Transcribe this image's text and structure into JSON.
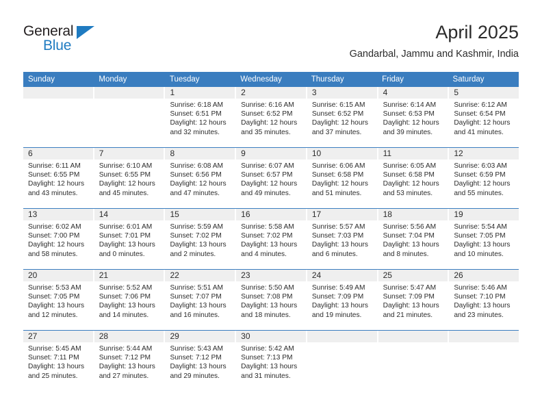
{
  "brand": {
    "name_part1": "General",
    "name_part2": "Blue",
    "accent_color": "#1f7bc1"
  },
  "header": {
    "title": "April 2025",
    "subtitle": "Gandarbal, Jammu and Kashmir, India"
  },
  "colors": {
    "header_blue": "#3a7dbf",
    "day_band_gray": "#efefef",
    "text": "#2b2b2b"
  },
  "weekdays": [
    "Sunday",
    "Monday",
    "Tuesday",
    "Wednesday",
    "Thursday",
    "Friday",
    "Saturday"
  ],
  "weeks": [
    [
      {
        "day": "",
        "sunrise": "",
        "sunset": "",
        "daylight_line1": "",
        "daylight_line2": "",
        "empty": true
      },
      {
        "day": "",
        "sunrise": "",
        "sunset": "",
        "daylight_line1": "",
        "daylight_line2": "",
        "empty": true
      },
      {
        "day": "1",
        "sunrise": "Sunrise: 6:18 AM",
        "sunset": "Sunset: 6:51 PM",
        "daylight_line1": "Daylight: 12 hours",
        "daylight_line2": "and 32 minutes."
      },
      {
        "day": "2",
        "sunrise": "Sunrise: 6:16 AM",
        "sunset": "Sunset: 6:52 PM",
        "daylight_line1": "Daylight: 12 hours",
        "daylight_line2": "and 35 minutes."
      },
      {
        "day": "3",
        "sunrise": "Sunrise: 6:15 AM",
        "sunset": "Sunset: 6:52 PM",
        "daylight_line1": "Daylight: 12 hours",
        "daylight_line2": "and 37 minutes."
      },
      {
        "day": "4",
        "sunrise": "Sunrise: 6:14 AM",
        "sunset": "Sunset: 6:53 PM",
        "daylight_line1": "Daylight: 12 hours",
        "daylight_line2": "and 39 minutes."
      },
      {
        "day": "5",
        "sunrise": "Sunrise: 6:12 AM",
        "sunset": "Sunset: 6:54 PM",
        "daylight_line1": "Daylight: 12 hours",
        "daylight_line2": "and 41 minutes."
      }
    ],
    [
      {
        "day": "6",
        "sunrise": "Sunrise: 6:11 AM",
        "sunset": "Sunset: 6:55 PM",
        "daylight_line1": "Daylight: 12 hours",
        "daylight_line2": "and 43 minutes."
      },
      {
        "day": "7",
        "sunrise": "Sunrise: 6:10 AM",
        "sunset": "Sunset: 6:55 PM",
        "daylight_line1": "Daylight: 12 hours",
        "daylight_line2": "and 45 minutes."
      },
      {
        "day": "8",
        "sunrise": "Sunrise: 6:08 AM",
        "sunset": "Sunset: 6:56 PM",
        "daylight_line1": "Daylight: 12 hours",
        "daylight_line2": "and 47 minutes."
      },
      {
        "day": "9",
        "sunrise": "Sunrise: 6:07 AM",
        "sunset": "Sunset: 6:57 PM",
        "daylight_line1": "Daylight: 12 hours",
        "daylight_line2": "and 49 minutes."
      },
      {
        "day": "10",
        "sunrise": "Sunrise: 6:06 AM",
        "sunset": "Sunset: 6:58 PM",
        "daylight_line1": "Daylight: 12 hours",
        "daylight_line2": "and 51 minutes."
      },
      {
        "day": "11",
        "sunrise": "Sunrise: 6:05 AM",
        "sunset": "Sunset: 6:58 PM",
        "daylight_line1": "Daylight: 12 hours",
        "daylight_line2": "and 53 minutes."
      },
      {
        "day": "12",
        "sunrise": "Sunrise: 6:03 AM",
        "sunset": "Sunset: 6:59 PM",
        "daylight_line1": "Daylight: 12 hours",
        "daylight_line2": "and 55 minutes."
      }
    ],
    [
      {
        "day": "13",
        "sunrise": "Sunrise: 6:02 AM",
        "sunset": "Sunset: 7:00 PM",
        "daylight_line1": "Daylight: 12 hours",
        "daylight_line2": "and 58 minutes."
      },
      {
        "day": "14",
        "sunrise": "Sunrise: 6:01 AM",
        "sunset": "Sunset: 7:01 PM",
        "daylight_line1": "Daylight: 13 hours",
        "daylight_line2": "and 0 minutes."
      },
      {
        "day": "15",
        "sunrise": "Sunrise: 5:59 AM",
        "sunset": "Sunset: 7:02 PM",
        "daylight_line1": "Daylight: 13 hours",
        "daylight_line2": "and 2 minutes."
      },
      {
        "day": "16",
        "sunrise": "Sunrise: 5:58 AM",
        "sunset": "Sunset: 7:02 PM",
        "daylight_line1": "Daylight: 13 hours",
        "daylight_line2": "and 4 minutes."
      },
      {
        "day": "17",
        "sunrise": "Sunrise: 5:57 AM",
        "sunset": "Sunset: 7:03 PM",
        "daylight_line1": "Daylight: 13 hours",
        "daylight_line2": "and 6 minutes."
      },
      {
        "day": "18",
        "sunrise": "Sunrise: 5:56 AM",
        "sunset": "Sunset: 7:04 PM",
        "daylight_line1": "Daylight: 13 hours",
        "daylight_line2": "and 8 minutes."
      },
      {
        "day": "19",
        "sunrise": "Sunrise: 5:54 AM",
        "sunset": "Sunset: 7:05 PM",
        "daylight_line1": "Daylight: 13 hours",
        "daylight_line2": "and 10 minutes."
      }
    ],
    [
      {
        "day": "20",
        "sunrise": "Sunrise: 5:53 AM",
        "sunset": "Sunset: 7:05 PM",
        "daylight_line1": "Daylight: 13 hours",
        "daylight_line2": "and 12 minutes."
      },
      {
        "day": "21",
        "sunrise": "Sunrise: 5:52 AM",
        "sunset": "Sunset: 7:06 PM",
        "daylight_line1": "Daylight: 13 hours",
        "daylight_line2": "and 14 minutes."
      },
      {
        "day": "22",
        "sunrise": "Sunrise: 5:51 AM",
        "sunset": "Sunset: 7:07 PM",
        "daylight_line1": "Daylight: 13 hours",
        "daylight_line2": "and 16 minutes."
      },
      {
        "day": "23",
        "sunrise": "Sunrise: 5:50 AM",
        "sunset": "Sunset: 7:08 PM",
        "daylight_line1": "Daylight: 13 hours",
        "daylight_line2": "and 18 minutes."
      },
      {
        "day": "24",
        "sunrise": "Sunrise: 5:49 AM",
        "sunset": "Sunset: 7:09 PM",
        "daylight_line1": "Daylight: 13 hours",
        "daylight_line2": "and 19 minutes."
      },
      {
        "day": "25",
        "sunrise": "Sunrise: 5:47 AM",
        "sunset": "Sunset: 7:09 PM",
        "daylight_line1": "Daylight: 13 hours",
        "daylight_line2": "and 21 minutes."
      },
      {
        "day": "26",
        "sunrise": "Sunrise: 5:46 AM",
        "sunset": "Sunset: 7:10 PM",
        "daylight_line1": "Daylight: 13 hours",
        "daylight_line2": "and 23 minutes."
      }
    ],
    [
      {
        "day": "27",
        "sunrise": "Sunrise: 5:45 AM",
        "sunset": "Sunset: 7:11 PM",
        "daylight_line1": "Daylight: 13 hours",
        "daylight_line2": "and 25 minutes."
      },
      {
        "day": "28",
        "sunrise": "Sunrise: 5:44 AM",
        "sunset": "Sunset: 7:12 PM",
        "daylight_line1": "Daylight: 13 hours",
        "daylight_line2": "and 27 minutes."
      },
      {
        "day": "29",
        "sunrise": "Sunrise: 5:43 AM",
        "sunset": "Sunset: 7:12 PM",
        "daylight_line1": "Daylight: 13 hours",
        "daylight_line2": "and 29 minutes."
      },
      {
        "day": "30",
        "sunrise": "Sunrise: 5:42 AM",
        "sunset": "Sunset: 7:13 PM",
        "daylight_line1": "Daylight: 13 hours",
        "daylight_line2": "and 31 minutes."
      },
      {
        "day": "",
        "sunrise": "",
        "sunset": "",
        "daylight_line1": "",
        "daylight_line2": "",
        "empty": true
      },
      {
        "day": "",
        "sunrise": "",
        "sunset": "",
        "daylight_line1": "",
        "daylight_line2": "",
        "empty": true
      },
      {
        "day": "",
        "sunrise": "",
        "sunset": "",
        "daylight_line1": "",
        "daylight_line2": "",
        "empty": true
      }
    ]
  ]
}
